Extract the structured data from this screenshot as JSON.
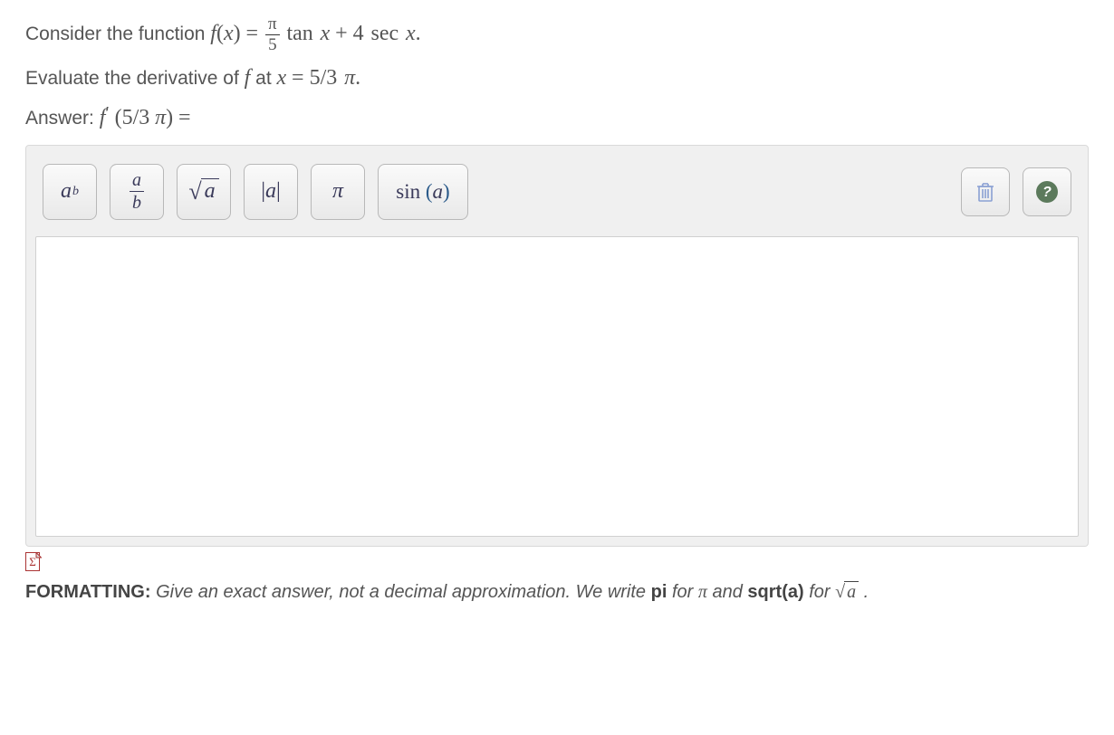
{
  "problem": {
    "line1_prefix": "Consider the function ",
    "func_lhs_var": "f",
    "func_lhs_arg": "x",
    "coef_frac_num": "π",
    "coef_frac_den": "5",
    "term1_fn": "tan",
    "term1_arg": "x",
    "plus": " + ",
    "term2_coef": "4",
    "term2_fn": "sec",
    "term2_arg": "x",
    "period": ".",
    "line2_prefix": "Evaluate the derivative of ",
    "line2_mid": " at ",
    "eval_var": "f",
    "eval_at_lhs": "x",
    "eval_at_eq": " = ",
    "eval_at_val": "5/3",
    "eval_at_suffix": "π",
    "line3_prefix": "Answer: ",
    "ans_lhs_f": "f",
    "ans_lhs_prime": "′",
    "ans_arg": "5/3",
    "ans_arg_suffix": "π",
    "ans_eq": " = "
  },
  "toolbar": {
    "exp_base": "a",
    "exp_sup": "b",
    "frac_num": "a",
    "frac_den": "b",
    "sqrt_arg": "a",
    "abs_arg": "a",
    "pi": "π",
    "sin_label": "sin",
    "sin_arg": "a"
  },
  "formatting": {
    "label": "FORMATTING:",
    "text1": " Give an exact answer, not a decimal approximation.  We write ",
    "pi_code": "pi",
    "text2": " for ",
    "pi_sym": "π",
    "text3": " and ",
    "sqrt_code": "sqrt(a)",
    "text4": " for ",
    "sqrt_arg": "a",
    "period": "."
  }
}
